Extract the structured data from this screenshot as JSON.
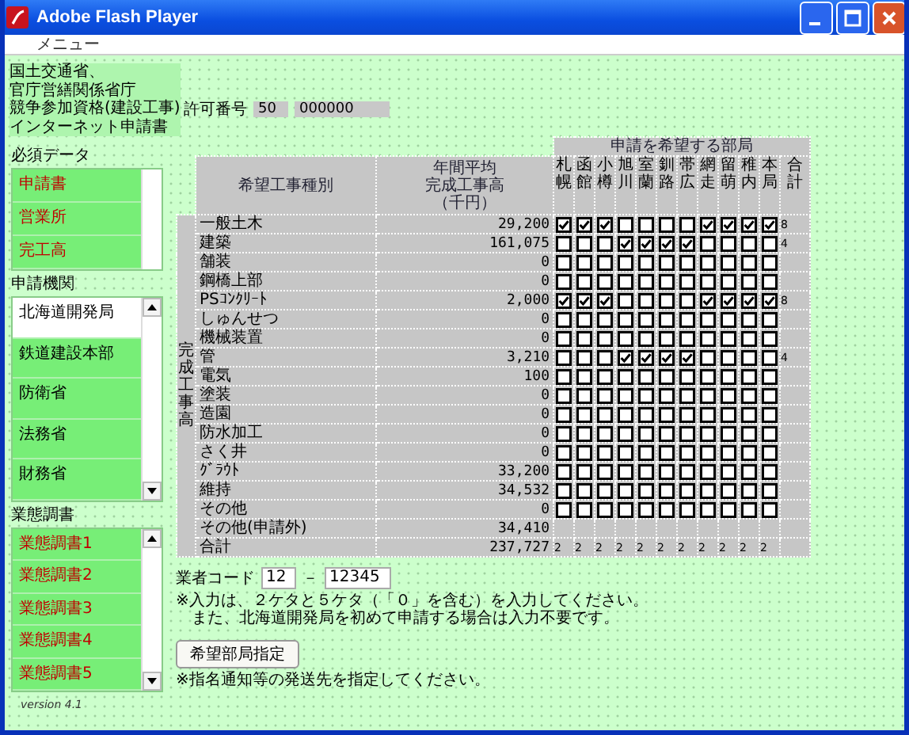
{
  "window": {
    "title": "Adobe Flash Player"
  },
  "menu": [
    "メニュー"
  ],
  "header_lines": [
    "国土交通省、",
    "官庁営繕関係省庁",
    "競争参加資格(建設工事)",
    "インターネット申請書"
  ],
  "permit": {
    "label": "許可番号",
    "part_1": "50",
    "part_2": "000000"
  },
  "required_data": {
    "title": "必須データ",
    "items": [
      {
        "label": "申請書"
      },
      {
        "label": "営業所"
      },
      {
        "label": "完工高"
      }
    ]
  },
  "agencies": {
    "title": "申請機関",
    "items": [
      {
        "label": "北海道開発局",
        "selected": true
      },
      {
        "label": "鉄道建設本部",
        "selected": false
      },
      {
        "label": "防衛省",
        "selected": false
      },
      {
        "label": "法務省",
        "selected": false
      },
      {
        "label": "財務省",
        "selected": false
      }
    ]
  },
  "business_reports": {
    "title": "業態調書",
    "items": [
      {
        "label": "業態調書1"
      },
      {
        "label": "業態調書2"
      },
      {
        "label": "業態調書3"
      },
      {
        "label": "業態調書4"
      },
      {
        "label": "業態調書5"
      }
    ]
  },
  "version": "version 4.1",
  "table": {
    "group_header": "申請を希望する部局",
    "name_header": "希望工事種別",
    "value_header": [
      "年間平均",
      "完成工事高",
      "（千円）"
    ],
    "side_label": "完成工事高",
    "departments": [
      "札幌",
      "函館",
      "小樽",
      "旭川",
      "室蘭",
      "釧路",
      "帯広",
      "網走",
      "留萌",
      "稚内",
      "本局",
      "合計"
    ],
    "rows": [
      {
        "kind": "check",
        "name": "一般土木",
        "value": "29,200",
        "checks": [
          true,
          true,
          true,
          false,
          false,
          false,
          false,
          true,
          true,
          true,
          true
        ],
        "total": "8"
      },
      {
        "kind": "check",
        "name": "建築",
        "value": "161,075",
        "checks": [
          false,
          false,
          false,
          true,
          true,
          true,
          true,
          false,
          false,
          false,
          false
        ],
        "total": "4"
      },
      {
        "kind": "check",
        "name": "舗装",
        "value": "0",
        "checks": [
          false,
          false,
          false,
          false,
          false,
          false,
          false,
          false,
          false,
          false,
          false
        ]
      },
      {
        "kind": "check",
        "name": "鋼橋上部",
        "value": "0",
        "checks": [
          false,
          false,
          false,
          false,
          false,
          false,
          false,
          false,
          false,
          false,
          false
        ]
      },
      {
        "kind": "check",
        "name": "PSｺﾝｸﾘｰﾄ",
        "value": "2,000",
        "checks": [
          true,
          true,
          true,
          false,
          false,
          false,
          false,
          true,
          true,
          true,
          true
        ],
        "total": "8"
      },
      {
        "kind": "check",
        "name": "しゅんせつ",
        "value": "0",
        "checks": [
          false,
          false,
          false,
          false,
          false,
          false,
          false,
          false,
          false,
          false,
          false
        ]
      },
      {
        "kind": "check",
        "name": "機械装置",
        "value": "0",
        "checks": [
          false,
          false,
          false,
          false,
          false,
          false,
          false,
          false,
          false,
          false,
          false
        ]
      },
      {
        "kind": "check",
        "name": "管",
        "value": "3,210",
        "checks": [
          false,
          false,
          false,
          true,
          true,
          true,
          true,
          false,
          false,
          false,
          false
        ],
        "total": "4"
      },
      {
        "kind": "check",
        "name": "電気",
        "value": "100",
        "checks": [
          false,
          false,
          false,
          false,
          false,
          false,
          false,
          false,
          false,
          false,
          false
        ]
      },
      {
        "kind": "check",
        "name": "塗装",
        "value": "0",
        "checks": [
          false,
          false,
          false,
          false,
          false,
          false,
          false,
          false,
          false,
          false,
          false
        ]
      },
      {
        "kind": "check",
        "name": "造園",
        "value": "0",
        "checks": [
          false,
          false,
          false,
          false,
          false,
          false,
          false,
          false,
          false,
          false,
          false
        ]
      },
      {
        "kind": "check",
        "name": "防水加工",
        "value": "0",
        "checks": [
          false,
          false,
          false,
          false,
          false,
          false,
          false,
          false,
          false,
          false,
          false
        ]
      },
      {
        "kind": "check",
        "name": "さく井",
        "value": "0",
        "checks": [
          false,
          false,
          false,
          false,
          false,
          false,
          false,
          false,
          false,
          false,
          false
        ]
      },
      {
        "kind": "check",
        "name": "ｸﾞﾗｳﾄ",
        "value": "33,200",
        "checks": [
          false,
          false,
          false,
          false,
          false,
          false,
          false,
          false,
          false,
          false,
          false
        ]
      },
      {
        "kind": "check",
        "name": "維持",
        "value": "34,532",
        "checks": [
          false,
          false,
          false,
          false,
          false,
          false,
          false,
          false,
          false,
          false,
          false
        ]
      },
      {
        "kind": "check",
        "name": "その他",
        "value": "0",
        "checks": [
          false,
          false,
          false,
          false,
          false,
          false,
          false,
          false,
          false,
          false,
          false
        ]
      },
      {
        "kind": "plain",
        "name": "その他(申請外)",
        "value": "34,410"
      },
      {
        "kind": "count",
        "name": "合計",
        "value": "237,727",
        "counts": [
          "2",
          "2",
          "2",
          "2",
          "2",
          "2",
          "2",
          "2",
          "2",
          "2",
          "2"
        ]
      }
    ]
  },
  "vendor_code": {
    "label": "業者コード",
    "part_1": "12",
    "separator": "－",
    "part_2": "12345"
  },
  "notes": [
    "※入力は、２ケタと５ケタ（「０」を含む）を入力してください。",
    "　また、北海道開発局を初めて申請する場合は入力不要です。"
  ],
  "button": "希望部局指定",
  "button_note": "※指名通知等の発送先を指定してください。"
}
